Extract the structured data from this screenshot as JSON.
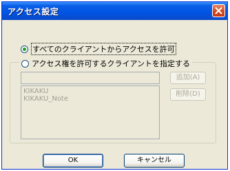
{
  "window": {
    "title": "アクセス設定",
    "close_icon": "close-icon"
  },
  "options": {
    "all_clients_label": "すべてのクライアントからアクセスを許可",
    "specified_clients_label": "アクセス権を許可するクライアントを指定する",
    "selected": "all_clients"
  },
  "client_input": {
    "value": ""
  },
  "client_list": {
    "items": [
      "KIKAKU",
      "KIKAKU_Note"
    ]
  },
  "buttons": {
    "add_label": "追加(A)",
    "delete_label": "削除(D)",
    "ok_label": "OK",
    "cancel_label": "キャンセル"
  }
}
